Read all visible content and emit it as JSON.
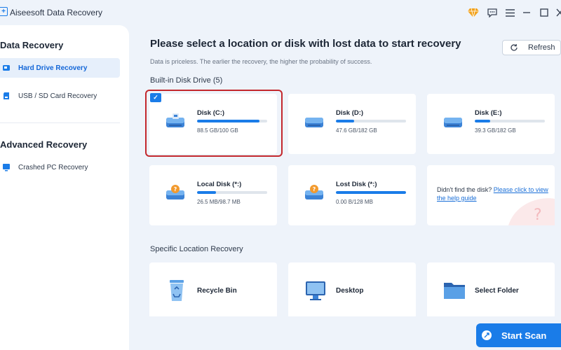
{
  "window": {
    "title": "Aiseesoft Data Recovery",
    "logo_glyph": "+",
    "controls": [
      "diamond-icon",
      "feedback-icon",
      "menu-icon",
      "minimize-icon",
      "maximize-icon",
      "close-icon"
    ]
  },
  "sidebar": {
    "data_recovery_heading": "Data Recovery",
    "advanced_recovery_heading": "Advanced Recovery",
    "items": [
      {
        "label": "Hard Drive Recovery",
        "icon": "hard-drive-icon",
        "active": true
      },
      {
        "label": "USB / SD Card Recovery",
        "icon": "sd-card-icon",
        "active": false
      },
      {
        "label": "Crashed PC Recovery",
        "icon": "crashed-pc-icon",
        "active": false
      }
    ]
  },
  "main": {
    "title": "Please select a location or disk with lost data to start recovery",
    "subtitle": "Data is priceless. The earlier the recovery, the higher the probability of success.",
    "refresh_label": "Refresh",
    "builtin_label": "Built-in Disk Drive (5)",
    "disks": [
      {
        "name": "Disk (C:)",
        "size": "88.5 GB/100 GB",
        "usage": 0.885,
        "selected": true,
        "icon": "drive-icon"
      },
      {
        "name": "Disk (D:)",
        "size": "47.6 GB/182 GB",
        "usage": 0.26,
        "selected": false,
        "icon": "drive-icon"
      },
      {
        "name": "Disk (E:)",
        "size": "39.3 GB/182 GB",
        "usage": 0.22,
        "selected": false,
        "icon": "drive-icon"
      },
      {
        "name": "Local Disk (*:)",
        "size": "26.5 MB/98.7 MB",
        "usage": 0.27,
        "selected": false,
        "icon": "unknown-drive-icon"
      },
      {
        "name": "Lost Disk (*:)",
        "size": "0.00 B/128 MB",
        "usage": 1.0,
        "selected": false,
        "icon": "unknown-drive-icon"
      }
    ],
    "help_text": "Didn't find the disk?",
    "help_link": "Please click to view the help guide",
    "specific_label": "Specific Location Recovery",
    "locations": [
      {
        "name": "Recycle Bin",
        "icon": "recycle-bin-icon"
      },
      {
        "name": "Desktop",
        "icon": "desktop-icon"
      },
      {
        "name": "Select Folder",
        "icon": "folder-icon"
      }
    ],
    "start_scan_label": "Start Scan"
  },
  "colors": {
    "accent": "#1a7ce8",
    "background": "#eef3fa",
    "selection_outline": "#c3282d"
  }
}
